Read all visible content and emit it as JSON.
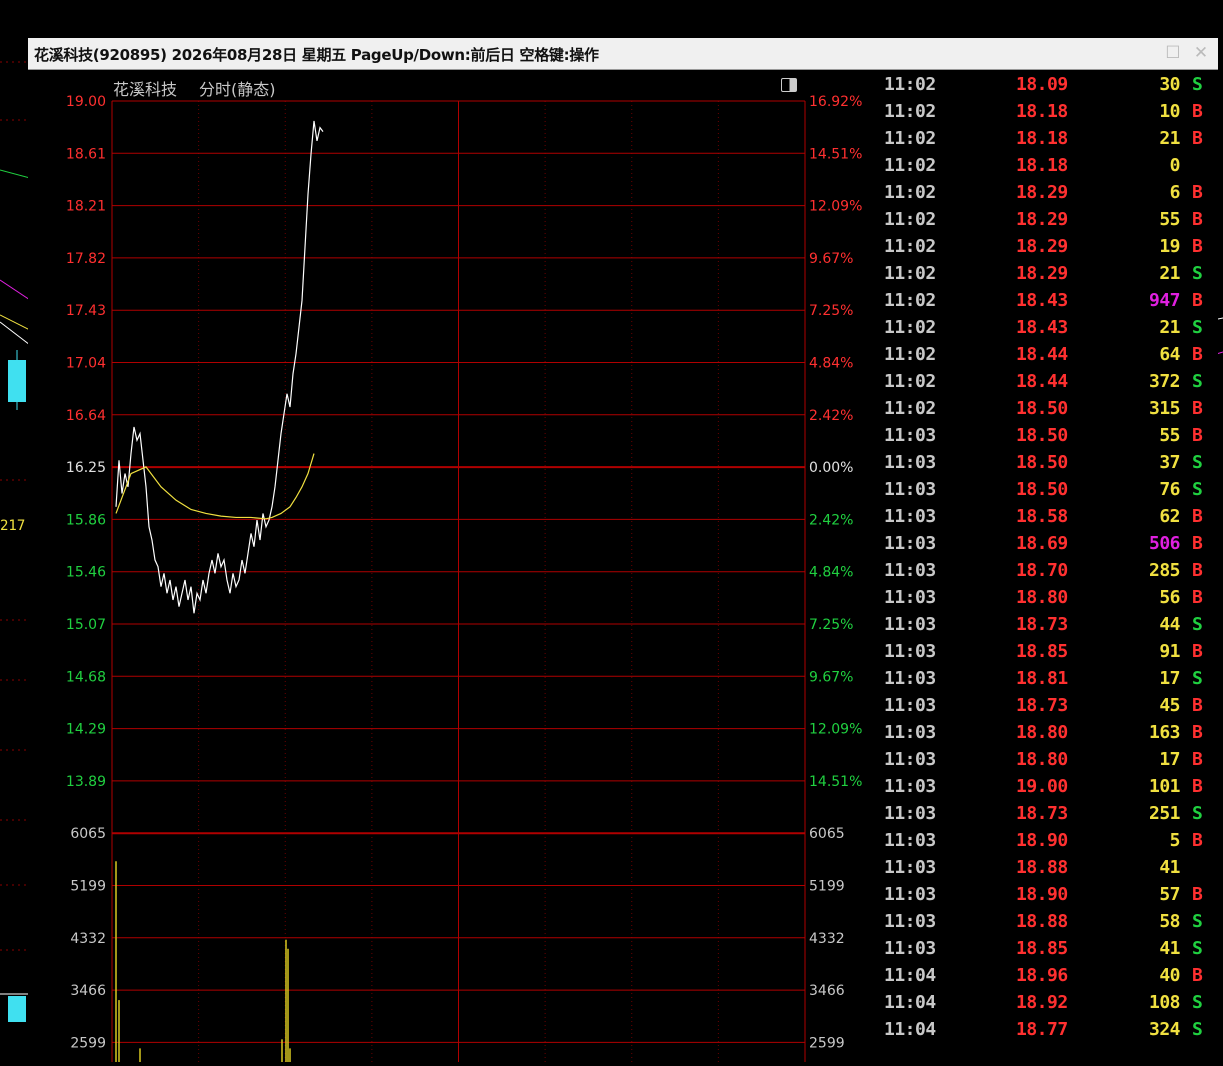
{
  "window": {
    "title": "花溪科技(920895) 2026年08月28日 星期五 PageUp/Down:前后日 空格键:操作",
    "restore_icon": "restore-icon",
    "close_icon": "close-icon"
  },
  "chart": {
    "stock_name": "花溪科技",
    "mode_label": "分时(静态)",
    "toggle_icon": "panel-toggle-icon",
    "price_levels": [
      "19.00",
      "18.61",
      "18.21",
      "17.82",
      "17.43",
      "17.04",
      "16.64",
      "16.25",
      "15.86",
      "15.46",
      "15.07",
      "14.68",
      "14.29",
      "13.89"
    ],
    "pct_levels": [
      "16.92%",
      "14.51%",
      "12.09%",
      "9.67%",
      "7.25%",
      "4.84%",
      "2.42%",
      "0.00%",
      "2.42%",
      "4.84%",
      "7.25%",
      "9.67%",
      "12.09%",
      "14.51%"
    ],
    "volume_levels": [
      "6065",
      "5199",
      "4332",
      "3466",
      "2599"
    ],
    "colors": {
      "up": "#ff3030",
      "down": "#20d040",
      "grid": "#b00000",
      "price_line": "#ffffff",
      "avg_line": "#f0e040",
      "volume": "#d8c820"
    }
  },
  "left_edge_label": "217",
  "chart_data": {
    "type": "line",
    "title": "花溪科技 分时(静态)",
    "prev_close": 16.25,
    "ylim": [
      13.89,
      19.0
    ],
    "series": [
      {
        "name": "price",
        "x": [
          0,
          1,
          2,
          3,
          4,
          5,
          6,
          7,
          8,
          9,
          10,
          11,
          12,
          13,
          14,
          15,
          16,
          17,
          18,
          19,
          20,
          21,
          22,
          23,
          24,
          25,
          26,
          27,
          28,
          29,
          30,
          31,
          32,
          33,
          34,
          35,
          36,
          37,
          38,
          39,
          40,
          41,
          42,
          43,
          44,
          45,
          46,
          47,
          48,
          49,
          50,
          51,
          52,
          53,
          54,
          55,
          56,
          57,
          58,
          59,
          60,
          61,
          62,
          63,
          64,
          65,
          66,
          67,
          68,
          69,
          70,
          71,
          72,
          73,
          74,
          75,
          76,
          77,
          78,
          79,
          80,
          81,
          82,
          83,
          84,
          85,
          86,
          87,
          88,
          89,
          90,
          91,
          92
        ],
        "values": [
          15.95,
          16.3,
          16.05,
          16.2,
          16.1,
          16.35,
          16.55,
          16.45,
          16.5,
          16.3,
          16.1,
          15.8,
          15.7,
          15.55,
          15.5,
          15.35,
          15.45,
          15.3,
          15.4,
          15.25,
          15.35,
          15.2,
          15.3,
          15.4,
          15.25,
          15.35,
          15.15,
          15.3,
          15.25,
          15.4,
          15.3,
          15.45,
          15.55,
          15.45,
          15.6,
          15.5,
          15.55,
          15.4,
          15.3,
          15.45,
          15.35,
          15.4,
          15.55,
          15.45,
          15.6,
          15.75,
          15.65,
          15.85,
          15.7,
          15.9,
          15.8,
          15.85,
          15.95,
          16.1,
          16.3,
          16.5,
          16.65,
          16.8,
          16.7,
          16.95,
          17.1,
          17.3,
          17.5,
          17.9,
          18.3,
          18.6,
          18.85,
          18.7,
          18.8,
          18.77,
          18.77,
          18.77,
          18.77,
          18.77,
          18.77,
          18.77,
          18.77,
          18.77,
          18.77,
          18.77,
          18.77,
          18.77,
          18.77,
          18.77,
          18.77,
          18.77,
          18.77,
          18.77,
          18.77,
          18.77,
          18.77,
          18.77,
          18.77
        ]
      },
      {
        "name": "average",
        "x": [
          0,
          5,
          10,
          15,
          20,
          25,
          30,
          35,
          40,
          45,
          50,
          52,
          55,
          58,
          60,
          62,
          64,
          66
        ],
        "values": [
          15.9,
          16.2,
          16.25,
          16.1,
          16.0,
          15.93,
          15.9,
          15.88,
          15.87,
          15.87,
          15.86,
          15.87,
          15.9,
          15.95,
          16.02,
          16.1,
          16.2,
          16.35
        ]
      }
    ]
  },
  "ticks": [
    {
      "time": "11:02",
      "price": "18.09",
      "vol": "30",
      "side": "S"
    },
    {
      "time": "11:02",
      "price": "18.18",
      "vol": "10",
      "side": "B"
    },
    {
      "time": "11:02",
      "price": "18.18",
      "vol": "21",
      "side": "B"
    },
    {
      "time": "11:02",
      "price": "18.18",
      "vol": "0",
      "side": ""
    },
    {
      "time": "11:02",
      "price": "18.29",
      "vol": "6",
      "side": "B"
    },
    {
      "time": "11:02",
      "price": "18.29",
      "vol": "55",
      "side": "B"
    },
    {
      "time": "11:02",
      "price": "18.29",
      "vol": "19",
      "side": "B"
    },
    {
      "time": "11:02",
      "price": "18.29",
      "vol": "21",
      "side": "S"
    },
    {
      "time": "11:02",
      "price": "18.43",
      "vol": "947",
      "side": "B"
    },
    {
      "time": "11:02",
      "price": "18.43",
      "vol": "21",
      "side": "S"
    },
    {
      "time": "11:02",
      "price": "18.44",
      "vol": "64",
      "side": "B"
    },
    {
      "time": "11:02",
      "price": "18.44",
      "vol": "372",
      "side": "S"
    },
    {
      "time": "11:02",
      "price": "18.50",
      "vol": "315",
      "side": "B"
    },
    {
      "time": "11:03",
      "price": "18.50",
      "vol": "55",
      "side": "B"
    },
    {
      "time": "11:03",
      "price": "18.50",
      "vol": "37",
      "side": "S"
    },
    {
      "time": "11:03",
      "price": "18.50",
      "vol": "76",
      "side": "S"
    },
    {
      "time": "11:03",
      "price": "18.58",
      "vol": "62",
      "side": "B"
    },
    {
      "time": "11:03",
      "price": "18.69",
      "vol": "506",
      "side": "B"
    },
    {
      "time": "11:03",
      "price": "18.70",
      "vol": "285",
      "side": "B"
    },
    {
      "time": "11:03",
      "price": "18.80",
      "vol": "56",
      "side": "B"
    },
    {
      "time": "11:03",
      "price": "18.73",
      "vol": "44",
      "side": "S"
    },
    {
      "time": "11:03",
      "price": "18.85",
      "vol": "91",
      "side": "B"
    },
    {
      "time": "11:03",
      "price": "18.81",
      "vol": "17",
      "side": "S"
    },
    {
      "time": "11:03",
      "price": "18.73",
      "vol": "45",
      "side": "B"
    },
    {
      "time": "11:03",
      "price": "18.80",
      "vol": "163",
      "side": "B"
    },
    {
      "time": "11:03",
      "price": "18.80",
      "vol": "17",
      "side": "B"
    },
    {
      "time": "11:03",
      "price": "19.00",
      "vol": "101",
      "side": "B"
    },
    {
      "time": "11:03",
      "price": "18.73",
      "vol": "251",
      "side": "S"
    },
    {
      "time": "11:03",
      "price": "18.90",
      "vol": "5",
      "side": "B"
    },
    {
      "time": "11:03",
      "price": "18.88",
      "vol": "41",
      "side": ""
    },
    {
      "time": "11:03",
      "price": "18.90",
      "vol": "57",
      "side": "B"
    },
    {
      "time": "11:03",
      "price": "18.88",
      "vol": "58",
      "side": "S"
    },
    {
      "time": "11:03",
      "price": "18.85",
      "vol": "41",
      "side": "S"
    },
    {
      "time": "11:04",
      "price": "18.96",
      "vol": "40",
      "side": "B"
    },
    {
      "time": "11:04",
      "price": "18.92",
      "vol": "108",
      "side": "S"
    },
    {
      "time": "11:04",
      "price": "18.77",
      "vol": "324",
      "side": "S"
    }
  ]
}
